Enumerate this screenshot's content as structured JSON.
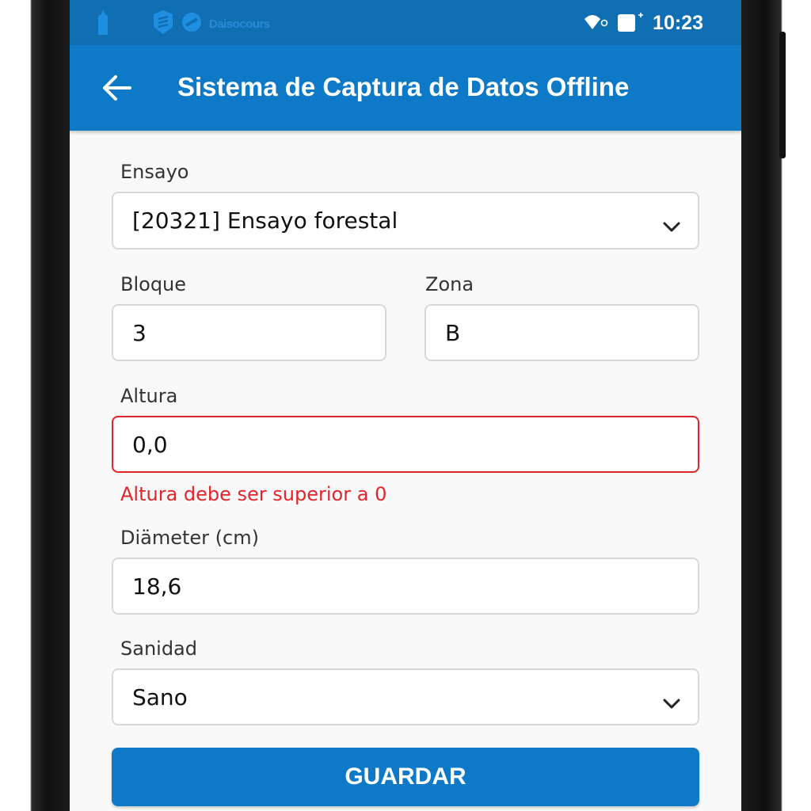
{
  "status_bar": {
    "brand_name": "Daisocours",
    "time": "10:23",
    "icons": [
      "bookmark-icon",
      "shield-icon",
      "no-entry-icon",
      "wifi-icon",
      "battery-icon"
    ]
  },
  "app_bar": {
    "title": "Sistema de Captura de Datos Offline",
    "back_icon": "arrow-left-icon"
  },
  "form": {
    "ensayo": {
      "label": "Ensayo",
      "value": "[20321] Ensayo forestal"
    },
    "bloque": {
      "label": "Bloque",
      "value": "3"
    },
    "zona": {
      "label": "Zona",
      "value": "B"
    },
    "altura": {
      "label": "Altura",
      "value": "0,0",
      "error": "Altura debe ser superior a 0"
    },
    "diametro": {
      "label": "Diämeter (cm)",
      "value": "18,6"
    },
    "sanidad": {
      "label": "Sanidad",
      "value": "Sano"
    },
    "save_label": "GUARDAR"
  },
  "colors": {
    "status_bar": "#0f6fb2",
    "app_bar": "#0d79c7",
    "button": "#0d79c7",
    "error": "#e3242b"
  }
}
